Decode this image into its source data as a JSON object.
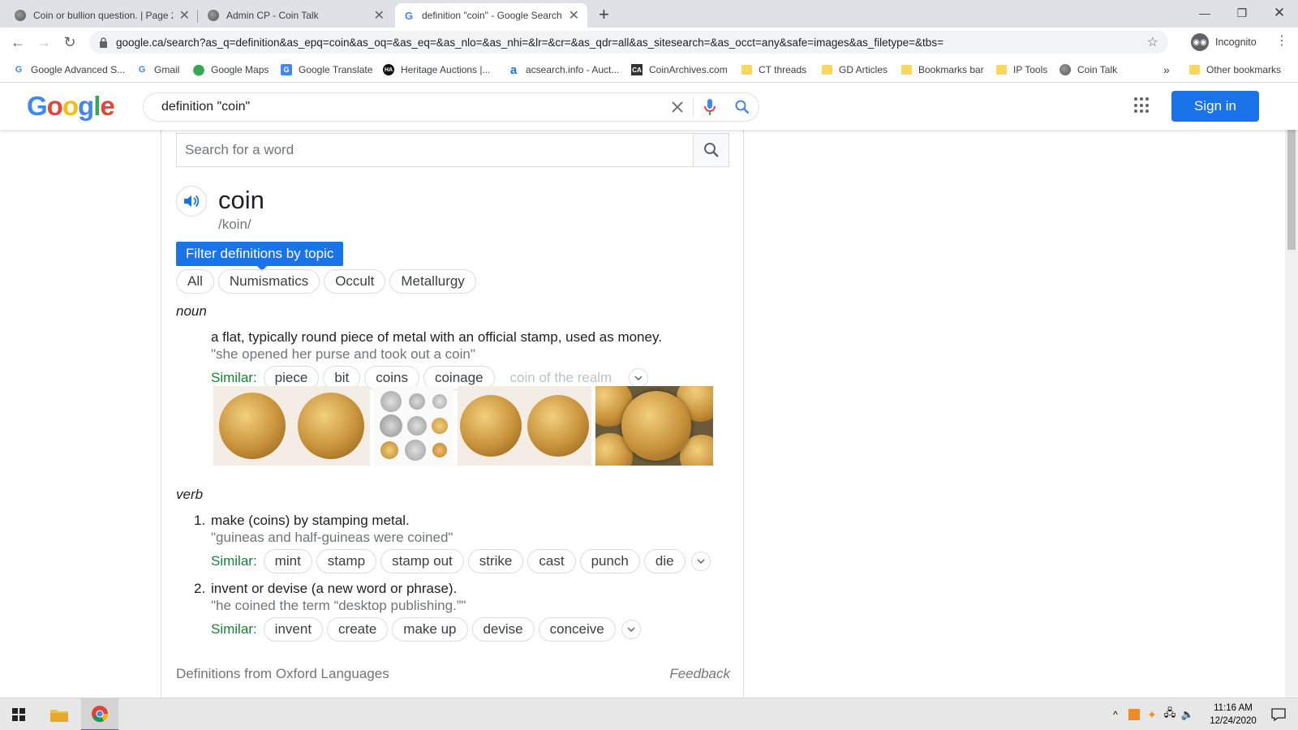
{
  "browser": {
    "tabs": [
      {
        "title": "Coin or bullion question. | Page 2",
        "active": false
      },
      {
        "title": "Admin CP - Coin Talk",
        "active": false
      },
      {
        "title": "definition \"coin\" - Google Search",
        "active": true
      }
    ],
    "url": "google.ca/search?as_q=definition&as_epq=coin&as_oq=&as_eq=&as_nlo=&as_nhi=&lr=&cr=&as_qdr=all&as_sitesearch=&as_occt=any&safe=images&as_filetype=&tbs=",
    "profile_label": "Incognito",
    "bookmarks": [
      {
        "label": "Google Advanced S...",
        "icon": "google-g-icon"
      },
      {
        "label": "Gmail",
        "icon": "google-g-icon"
      },
      {
        "label": "Google Maps",
        "icon": "map-pin-icon"
      },
      {
        "label": "Google Translate",
        "icon": "translate-icon"
      },
      {
        "label": "Heritage Auctions |...",
        "icon": "ha-icon"
      },
      {
        "label": "acsearch.info - Auct...",
        "icon": "acsearch-icon"
      },
      {
        "label": "CoinArchives.com",
        "icon": "ca-icon"
      },
      {
        "label": "CT threads",
        "icon": "folder-icon"
      },
      {
        "label": "GD Articles",
        "icon": "folder-icon"
      },
      {
        "label": "Bookmarks bar",
        "icon": "folder-icon"
      },
      {
        "label": "IP Tools",
        "icon": "folder-icon"
      },
      {
        "label": "Coin Talk",
        "icon": "coin-icon"
      }
    ],
    "overflow_label": "»",
    "other_bookmarks": "Other bookmarks"
  },
  "google": {
    "logo_letters": [
      "G",
      "o",
      "o",
      "g",
      "l",
      "e"
    ],
    "logo_colors": [
      "#4285f4",
      "#ea4335",
      "#fbbc05",
      "#4285f4",
      "#34a853",
      "#ea4335"
    ],
    "query": "definition \"coin\"",
    "sign_in": "Sign in"
  },
  "dictionary": {
    "search_placeholder": "Search for a word",
    "word": "coin",
    "phonetic": "/koin/",
    "filter_label": "Filter definitions by topic",
    "topics": [
      "All",
      "Numismatics",
      "Occult",
      "Metallurgy"
    ],
    "noun": {
      "pos": "noun",
      "definition": "a flat, typically round piece of metal with an official stamp, used as money.",
      "example": "\"she opened her purse and took out a coin\"",
      "similar_label": "Similar:",
      "similar": [
        "piece",
        "bit",
        "coins",
        "coinage"
      ],
      "similar_faded": "coin of the realm"
    },
    "verb": {
      "pos": "verb",
      "senses": [
        {
          "num": "1.",
          "definition": "make (coins) by stamping metal.",
          "example": "\"guineas and half-guineas were coined\"",
          "similar": [
            "mint",
            "stamp",
            "stamp out",
            "strike",
            "cast",
            "punch",
            "die"
          ]
        },
        {
          "num": "2.",
          "definition": "invent or devise (a new word or phrase).",
          "example": "\"he coined the term “desktop publishing.”\"",
          "similar": [
            "invent",
            "create",
            "make up",
            "devise",
            "conceive"
          ]
        }
      ]
    },
    "source": "Definitions from Oxford Languages",
    "feedback": "Feedback"
  },
  "taskbar": {
    "time": "11:16 AM",
    "date": "12/24/2020"
  },
  "colors": {
    "accent": "#1a73e8",
    "similar_green": "#188038"
  }
}
